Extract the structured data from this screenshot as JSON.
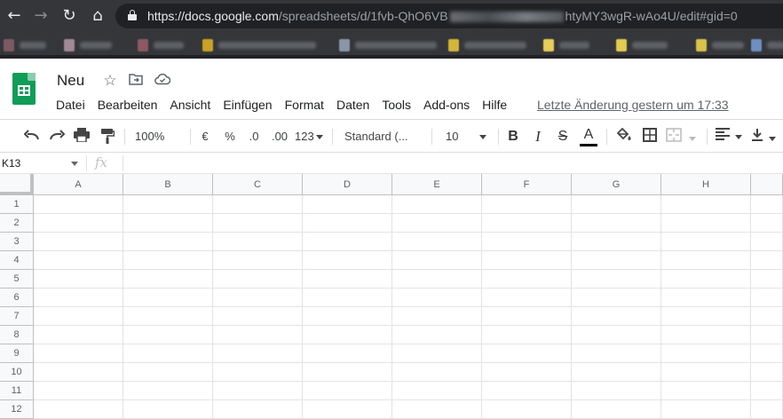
{
  "browser": {
    "url_host": "https://docs.google.com",
    "url_path_start": "/spreadsheets/d/1fvb-QhO6VB",
    "url_path_end": "htyMY3wgR-wAo4U/edit#gid=0"
  },
  "doc": {
    "title": "Neu",
    "last_edit": "Letzte Änderung gestern um 17:33"
  },
  "menu": [
    "Datei",
    "Bearbeiten",
    "Ansicht",
    "Einfügen",
    "Format",
    "Daten",
    "Tools",
    "Add-ons",
    "Hilfe"
  ],
  "toolbar": {
    "zoom": "100%",
    "currency": "€",
    "percent": "%",
    "decrease_decimals": ".0",
    "increase_decimals": ".00",
    "more_formats": "123",
    "font": "Standard (...",
    "font_size": "10",
    "bold": "B",
    "italic": "I",
    "strikethrough": "S",
    "text_color": "A"
  },
  "formula_bar": {
    "cell_ref": "K13",
    "fx": "fx"
  },
  "columns": [
    "A",
    "B",
    "C",
    "D",
    "E",
    "F",
    "G",
    "H"
  ],
  "rows": [
    "1",
    "2",
    "3",
    "4",
    "5",
    "6",
    "7",
    "8",
    "9",
    "10",
    "11",
    "12"
  ],
  "colors": {
    "chrome_bg": "#35363a",
    "omnibox_bg": "#202124",
    "sheets_green": "#0f9d58",
    "header_bg": "#f8f9fa",
    "gridline": "#e2e3e3"
  }
}
